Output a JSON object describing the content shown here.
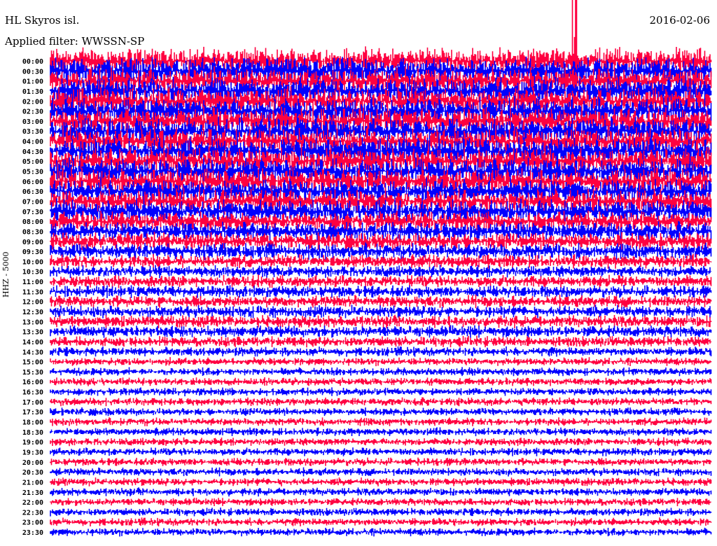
{
  "header": {
    "station": "HL Skyros isl.",
    "filter": "Applied filter: WWSSN-SP",
    "date": "2016-02-06",
    "channel": "HHZ - 5000"
  },
  "chart_data": {
    "type": "line",
    "title": "HL Skyros isl.",
    "subtitle": "Applied filter: WWSSN-SP",
    "ylabel": "HHZ - 5000",
    "row_labels": [
      "00:00",
      "00:30",
      "01:00",
      "01:30",
      "02:00",
      "02:30",
      "03:00",
      "03:30",
      "04:00",
      "04:30",
      "05:00",
      "05:30",
      "06:00",
      "06:30",
      "07:00",
      "07:30",
      "08:00",
      "08:30",
      "09:00",
      "09:30",
      "10:00",
      "10:30",
      "11:00",
      "11:30",
      "12:00",
      "12:30",
      "13:00",
      "13:30",
      "14:00",
      "14:30",
      "15:00",
      "15:30",
      "16:00",
      "16:30",
      "17:00",
      "17:30",
      "18:00",
      "18:30",
      "19:00",
      "19:30",
      "20:00",
      "20:30",
      "21:00",
      "21:30",
      "22:00",
      "22:30",
      "23:00",
      "23:30"
    ],
    "relative_amplitude": [
      1.0,
      1.0,
      1.0,
      1.0,
      1.0,
      1.0,
      1.0,
      1.0,
      1.0,
      1.0,
      1.0,
      1.0,
      0.95,
      0.9,
      0.9,
      0.85,
      0.75,
      0.7,
      0.65,
      0.6,
      0.5,
      0.45,
      0.45,
      0.45,
      0.45,
      0.45,
      0.45,
      0.45,
      0.4,
      0.35,
      0.3,
      0.3,
      0.3,
      0.3,
      0.3,
      0.3,
      0.3,
      0.3,
      0.3,
      0.3,
      0.3,
      0.3,
      0.3,
      0.3,
      0.3,
      0.3,
      0.3,
      0.3
    ],
    "trace_colors": [
      "#ff0040",
      "#0000ff"
    ],
    "events": [
      {
        "row": "00:00",
        "x_minutes": 22.5,
        "relative_amplitude": 6
      }
    ]
  }
}
